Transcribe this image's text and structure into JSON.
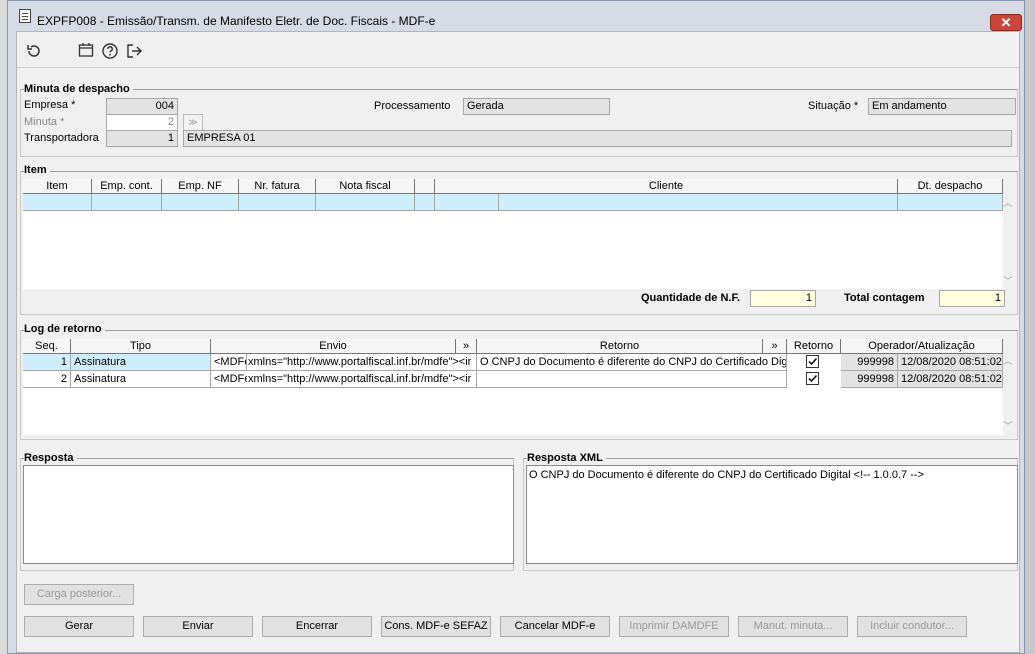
{
  "window": {
    "title": "EXPFP008 - Emissão/Transm. de Manifesto Eletr. de Doc. Fiscais - MDF-e",
    "close_label": "✕"
  },
  "toolbar": {
    "icons": [
      "refresh-icon",
      "calendar-icon",
      "help-icon",
      "exit-icon"
    ]
  },
  "minuta": {
    "group_label": "Minuta de despacho",
    "empresa_label": "Empresa *",
    "empresa_value": "004",
    "minuta_label": "Minuta *",
    "minuta_value": "2",
    "transportadora_label": "Transportadora",
    "transportadora_value": "1",
    "transportadora_name": "EMPRESA 01",
    "processamento_label": "Processamento",
    "processamento_value": "Gerada",
    "situacao_label": "Situação *",
    "situacao_value": "Em andamento"
  },
  "item": {
    "group_label": "Item",
    "columns": [
      "Item",
      "Emp. cont.",
      "Emp. NF",
      "Nr. fatura",
      "Nota fiscal",
      "Cliente",
      "Dt. despacho"
    ],
    "qtd_label": "Quantidade de N.F.",
    "qtd_value": "1",
    "total_label": "Total contagem",
    "total_value": "1"
  },
  "log": {
    "group_label": "Log de retorno",
    "columns": {
      "seq": "Seq.",
      "tipo": "Tipo",
      "envio": "Envio",
      "expand": "»",
      "retorno": "Retorno",
      "retorno_chk": "Retorno",
      "operador": "Operador/Atualização"
    },
    "rows": [
      {
        "seq": "1",
        "tipo": "Assinatura",
        "envio_a": "<MDFe",
        "envio_b": "xmlns=\"http://www.portalfiscal.inf.br/mdfe\"><ir",
        "retorno": "O CNPJ do Documento é diferente do CNPJ do Certificado Digita",
        "checked": true,
        "operador": "999998",
        "data": "12/08/2020 08:51:02"
      },
      {
        "seq": "2",
        "tipo": "Assinatura",
        "envio_a": "<MDFe",
        "envio_b": "xmlns=\"http://www.portalfiscal.inf.br/mdfe\"><ir",
        "retorno": "",
        "checked": true,
        "operador": "999998",
        "data": "12/08/2020 08:51:02"
      }
    ]
  },
  "resposta": {
    "label": "Resposta",
    "value": ""
  },
  "resposta_xml": {
    "label": "Resposta XML",
    "value": "O CNPJ do Documento é diferente do CNPJ do Certificado Digital <!--  1.0.0.7 -->"
  },
  "buttons": {
    "carga": "Carga posterior...",
    "gerar": "Gerar",
    "enviar": "Enviar",
    "encerrar": "Encerrar",
    "cons": "Cons. MDF-e SEFAZ",
    "cancelar": "Cancelar MDF-e",
    "imprimir": "Imprimir DAMDFE",
    "manut": "Manut. minuta...",
    "incluir": "Incluir condutor..."
  }
}
